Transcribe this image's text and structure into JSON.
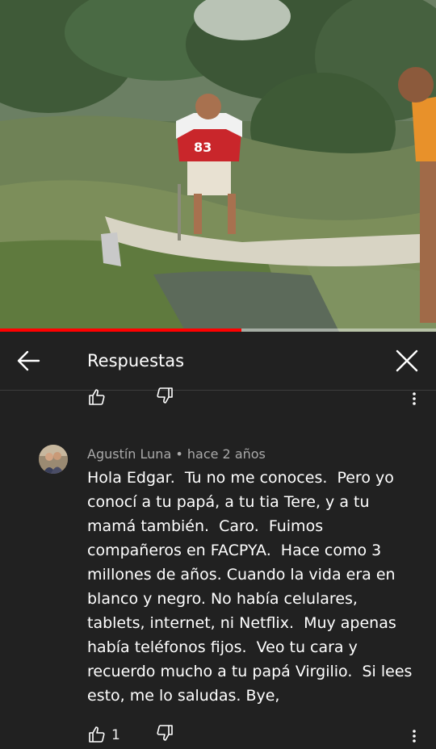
{
  "video": {
    "progress_fraction": 0.553,
    "jersey_number": "83",
    "accent_color": "#ff0000"
  },
  "header": {
    "title": "Respuestas",
    "back_icon": "arrow-left-icon",
    "close_icon": "close-icon"
  },
  "previous_reply": {
    "like_icon": "thumbs-up-icon",
    "dislike_icon": "thumbs-down-icon",
    "more_icon": "more-vert-icon"
  },
  "comment": {
    "author": "Agustín Luna",
    "separator": "•",
    "time": "hace 2 años",
    "text": "Hola Edgar.  Tu no me conoces.  Pero yo conocí a tu papá, a tu tia Tere, y a tu mamá también.  Caro.  Fuimos compañeros en FACPYA.  Hace como 3 millones de años. Cuando la vida era en blanco y negro. No había celulares, tablets, internet, ni Netflix.  Muy apenas había teléfonos fijos.  Veo tu cara y recuerdo mucho a tu papá Virgilio.  Si lees esto, me lo saludas. Bye,",
    "likes": "1"
  },
  "colors": {
    "background": "#212121",
    "text_primary": "#ffffff",
    "text_secondary": "#aaaaaa",
    "divider": "#3d3d3d"
  }
}
